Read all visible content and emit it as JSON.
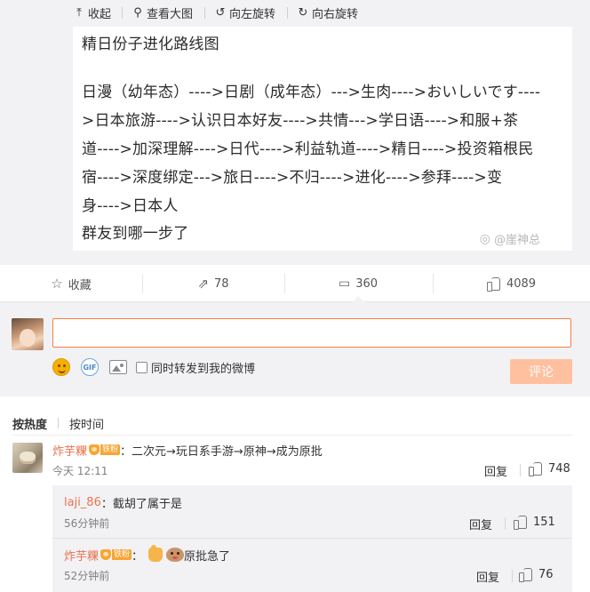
{
  "image_toolbar": {
    "collapse": "收起",
    "view_large": "查看大图",
    "rotate_left": "向左旋转",
    "rotate_right": "向右旋转"
  },
  "post_image": {
    "title": "精日份子进化路线图",
    "lines": [
      "日漫（幼年态）---->日剧（成年态）--->生肉---->おいしいです----",
      ">日本旅游---->认识日本好友---->共情--->学日语---->和服+茶",
      "道---->加深理解---->日代---->利益轨道---->精日---->投资箱根民",
      "宿---->深度绑定--->旅日---->不归---->进化---->参拜---->变",
      "身---->日本人",
      "群友到哪一步了"
    ],
    "watermark": "@崖神总"
  },
  "actions": {
    "favorite": "收藏",
    "repost_count": "78",
    "comment_count": "360",
    "like_count": "4089"
  },
  "composer": {
    "input_value": "",
    "forward_label": "同时转发到我的微博",
    "submit_label": "评论",
    "gif_label": "GIF"
  },
  "sort": {
    "hot": "按热度",
    "time": "按时间"
  },
  "comments": [
    {
      "nick": "炸芋粿",
      "badge_level": "铁粉",
      "text": "：二次元→玩日系手游→原神→成为原批",
      "time": "今天 12:11",
      "reply": "回复",
      "likes": "748",
      "replies": [
        {
          "nick": "laji_86",
          "text": "：截胡了属于是",
          "time": "56分钟前",
          "reply": "回复",
          "likes": "151"
        },
        {
          "nick": "炸芋粿",
          "badge_level": "铁粉",
          "text": "原批急了",
          "time": "52分钟前",
          "reply": "回复",
          "likes": "76"
        }
      ]
    }
  ],
  "colors": {
    "accent": "#fa7d3c",
    "nick": "#eb7350",
    "submit_disabled": "#ffc09f",
    "panel_bg": "#f2f2f5"
  }
}
